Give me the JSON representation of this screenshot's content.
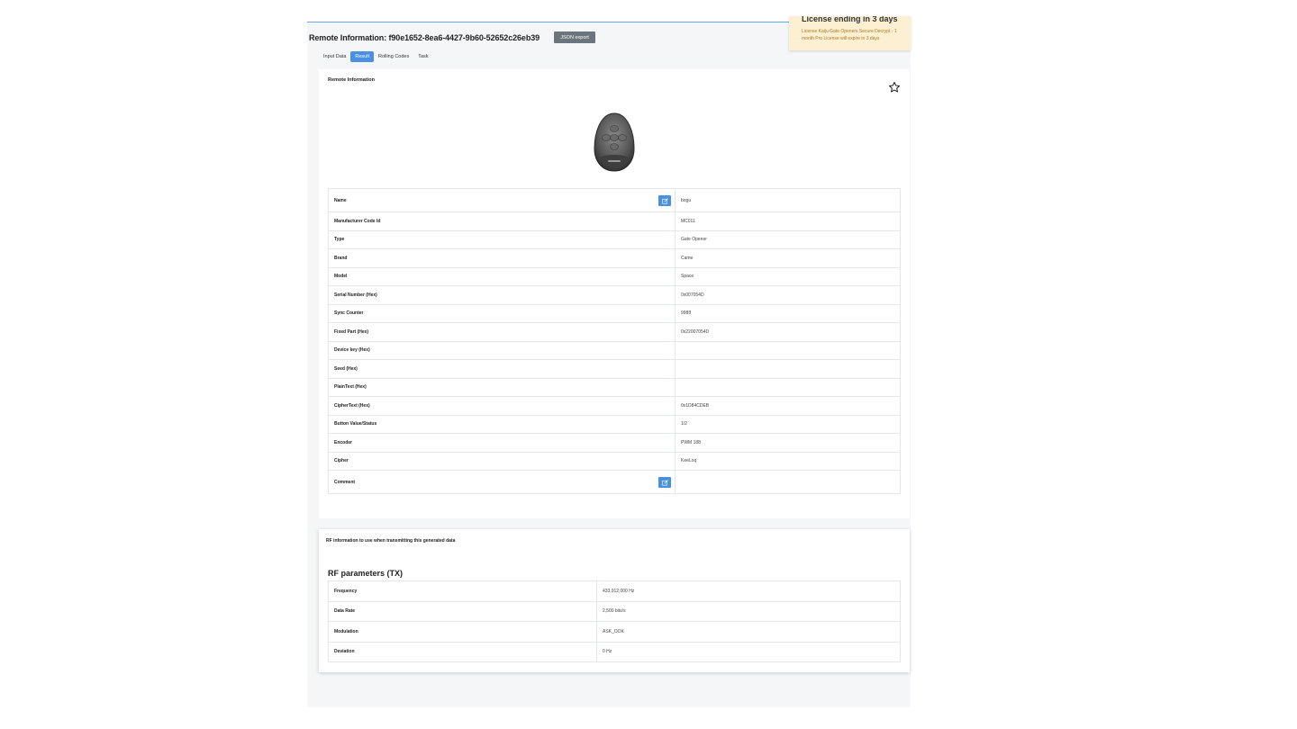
{
  "header": {
    "title": "Remote Information: f90e1652-8ea6-4427-9b60-52652c26eb39",
    "json_export_label": "JSON export"
  },
  "toast": {
    "title": "License ending in 3 days",
    "body": "License Kaiju Gate Openers Secure Decrypt - 1 month Pro License will expire in 3 days"
  },
  "tabs": [
    {
      "label": "Input Data",
      "active": false
    },
    {
      "label": "Result",
      "active": true
    },
    {
      "label": "Rolling Codes",
      "active": false
    },
    {
      "label": "Task",
      "active": false
    }
  ],
  "remote_card": {
    "title": "Remote Information",
    "rows": [
      {
        "label": "Name",
        "value": "bogu"
      },
      {
        "label": "Manufacturer Code Id",
        "value": "MC011"
      },
      {
        "label": "Type",
        "value": "Gate Opener"
      },
      {
        "label": "Brand",
        "value": "Came"
      },
      {
        "label": "Model",
        "value": "Space"
      },
      {
        "label": "Serial Number (Hex)",
        "value": "0x007054D"
      },
      {
        "label": "Sync Counter",
        "value": "9988"
      },
      {
        "label": "Fixed Part (Hex)",
        "value": "0x22007054D"
      },
      {
        "label": "Device key (Hex)",
        "value": ""
      },
      {
        "label": "Seed (Hex)",
        "value": ""
      },
      {
        "label": "PlainText (Hex)",
        "value": ""
      },
      {
        "label": "CipherText (Hex)",
        "value": "0x1D84CDEB"
      },
      {
        "label": "Button Value/Status",
        "value": "1/2"
      },
      {
        "label": "Encoder",
        "value": "PWM 188"
      },
      {
        "label": "Cipher",
        "value": "KeeLoq"
      },
      {
        "label": "Comment",
        "value": ""
      }
    ]
  },
  "rf_card": {
    "title": "RF information to use when transmitting this generated data",
    "section_title": "RF parameters (TX)",
    "rows": [
      {
        "label": "Frequency",
        "value": "433,912,000 Hz"
      },
      {
        "label": "Data Rate",
        "value": "2,500 bits/s"
      },
      {
        "label": "Modulation",
        "value": "ASK_OOK"
      },
      {
        "label": "Deviation",
        "value": "0 Hz"
      }
    ]
  },
  "colors": {
    "accent": "#4a90e2",
    "toast_bg": "#fcefd2",
    "toast_text": "#b07a20",
    "button_grey": "#6c757d"
  },
  "icons": {
    "star": "star-outline-icon",
    "edit": "edit-icon"
  }
}
